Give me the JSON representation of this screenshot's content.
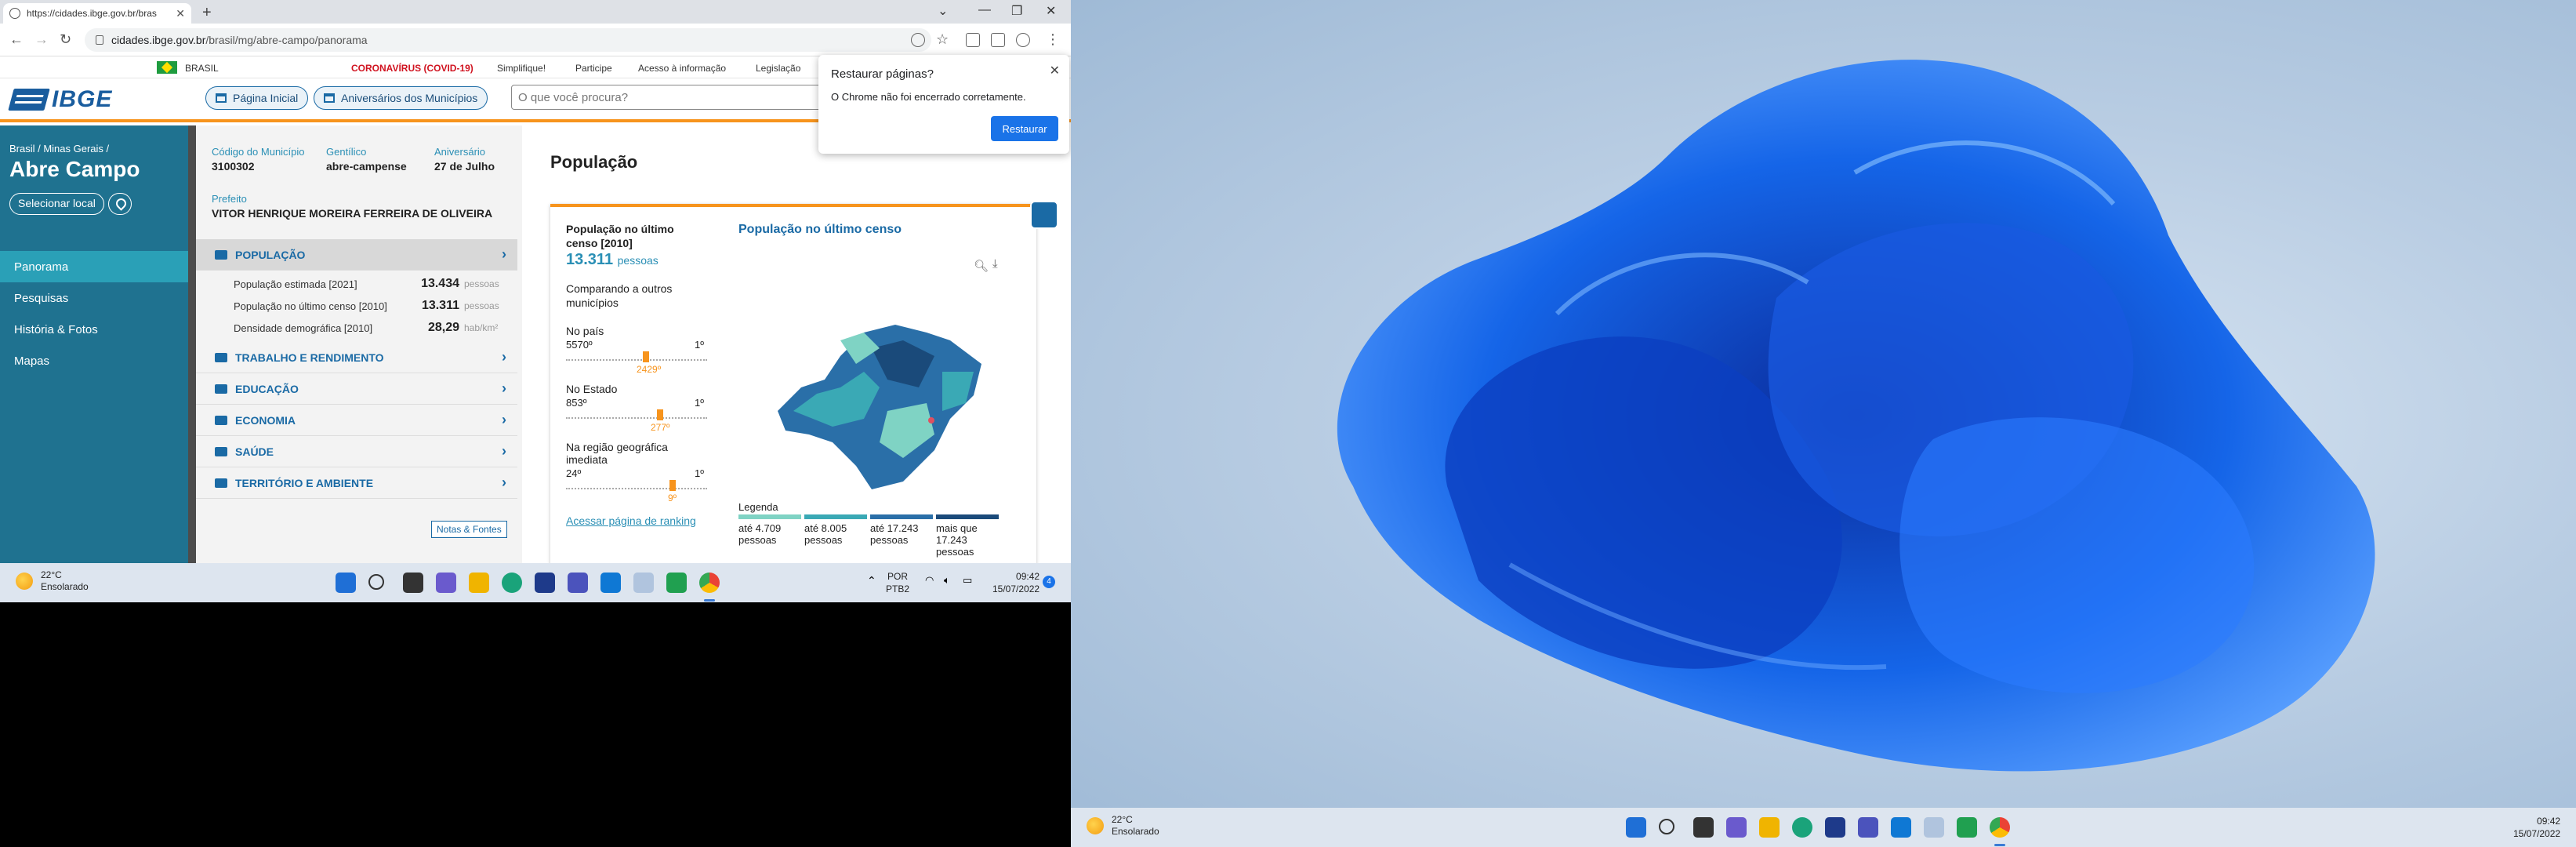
{
  "browser": {
    "tab_title": "https://cidades.ibge.gov.br/bras",
    "address_host": "cidades.ibge.gov.br",
    "address_path": "/brasil/mg/abre-campo/panorama"
  },
  "topbar": {
    "brasil": "BRASIL",
    "covid": "CORONAVÍRUS (COVID-19)",
    "simplifique": "Simplifique!",
    "participe": "Participe",
    "acesso": "Acesso à informação",
    "legislacao": "Legislação"
  },
  "header": {
    "logo": "IBGE",
    "home_btn": "Página Inicial",
    "aniv_btn": "Aniversários dos Municípios",
    "search_placeholder": "O que você procura?"
  },
  "dialog": {
    "title": "Restaurar páginas?",
    "message": "O Chrome não foi encerrado corretamente.",
    "button": "Restaurar"
  },
  "sidebar": {
    "breadcrumb": "Brasil / Minas Gerais /",
    "city": "Abre Campo",
    "select_btn": "Selecionar local",
    "items": [
      {
        "label": "Panorama"
      },
      {
        "label": "Pesquisas"
      },
      {
        "label": "História & Fotos"
      },
      {
        "label": "Mapas"
      }
    ]
  },
  "info": {
    "codigo_label": "Código do Município",
    "codigo_value": "3100302",
    "gentilico_label": "Gentílico",
    "gentilico_value": "abre-campense",
    "aniv_label": "Aniversário",
    "aniv_value": "27 de Julho",
    "prefeito_label": "Prefeito",
    "prefeito_value": "VITOR HENRIQUE MOREIRA FERREIRA DE OLIVEIRA",
    "sections": [
      {
        "label": "POPULAÇÃO"
      },
      {
        "label": "TRABALHO E RENDIMENTO"
      },
      {
        "label": "EDUCAÇÃO"
      },
      {
        "label": "ECONOMIA"
      },
      {
        "label": "SAÚDE"
      },
      {
        "label": "TERRITÓRIO E AMBIENTE"
      }
    ],
    "rows": [
      {
        "label": "População estimada [2021]",
        "value": "13.434",
        "unit": "pessoas"
      },
      {
        "label": "População no último censo [2010]",
        "value": "13.311",
        "unit": "pessoas"
      },
      {
        "label": "Densidade demográfica [2010]",
        "value": "28,29",
        "unit": "hab/km²"
      }
    ],
    "notas": "Notas & Fontes"
  },
  "main": {
    "title": "População",
    "card_head1": "População no último",
    "card_head2": "censo [2010]",
    "card_value": "13.311",
    "card_unit": "pessoas",
    "compare1": "Comparando a outros",
    "compare2": "municípios",
    "pais_label": "No país",
    "pais_total": "5570º",
    "pais_pos": "2429º",
    "estado_label": "No Estado",
    "estado_total": "853º",
    "estado_pos": "277º",
    "regiao_label1": "Na região geográfica",
    "regiao_label2": "imediata",
    "regiao_total": "24º",
    "regiao_pos": "9º",
    "first": "1º",
    "ranking_link": "Acessar página de ranking",
    "map_title": "População no último censo",
    "legend_title": "Legenda",
    "legend": [
      {
        "label": "até 4.709 pessoas",
        "color": "#7fd3c4"
      },
      {
        "label": "até 8.005 pessoas",
        "color": "#3aa9b5"
      },
      {
        "label": "até 17.243 pessoas",
        "color": "#2a6fa8"
      },
      {
        "label": "mais que 17.243 pessoas",
        "color": "#1a4a7a"
      }
    ]
  },
  "taskbar_left": {
    "temp": "22°C",
    "weather": "Ensolarado",
    "lang1": "POR",
    "lang2": "PTB2",
    "time": "09:42",
    "date": "15/07/2022",
    "notif": "4"
  },
  "taskbar_right": {
    "temp": "22°C",
    "weather": "Ensolarado",
    "time": "09:42",
    "date": "15/07/2022"
  }
}
